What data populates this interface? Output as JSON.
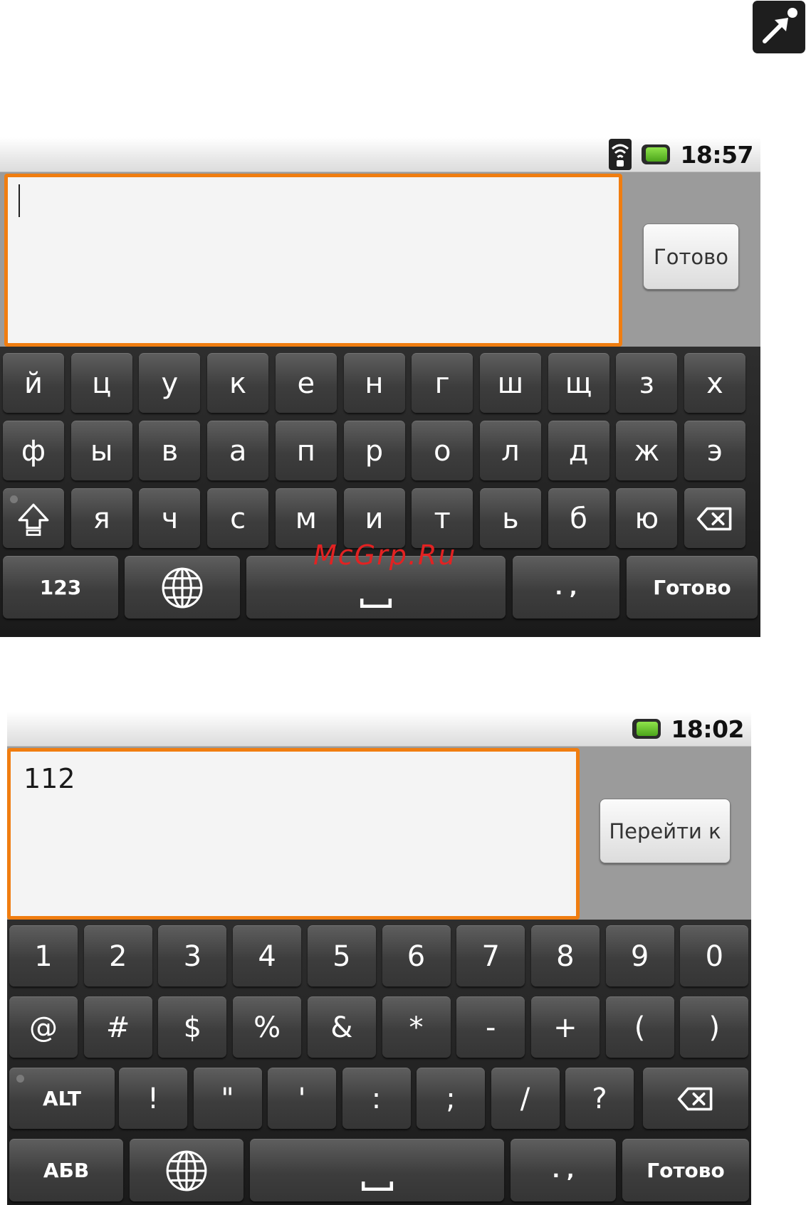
{
  "watermark": "McGrp.Ru",
  "corner_icon": "expand-arrow-icon",
  "screen1": {
    "status": {
      "time": "18:57",
      "icons": [
        "wifi-icon",
        "battery-icon"
      ]
    },
    "input": {
      "value": "",
      "action_label": "Готово"
    },
    "keyboard": {
      "rows": [
        [
          "й",
          "ц",
          "у",
          "к",
          "е",
          "н",
          "г",
          "ш",
          "щ",
          "з",
          "х"
        ],
        [
          "ф",
          "ы",
          "в",
          "а",
          "п",
          "р",
          "о",
          "л",
          "д",
          "ж",
          "э"
        ],
        [
          "я",
          "ч",
          "с",
          "м",
          "и",
          "т",
          "ь",
          "б",
          "ю"
        ]
      ],
      "bottom": {
        "mode_label": "123",
        "punct_label": ". ,",
        "done_label": "Готово"
      }
    }
  },
  "screen2": {
    "status": {
      "time": "18:02",
      "icons": [
        "battery-icon"
      ]
    },
    "input": {
      "value": "112",
      "action_label": "Перейти к"
    },
    "keyboard": {
      "rows": [
        [
          "1",
          "2",
          "3",
          "4",
          "5",
          "6",
          "7",
          "8",
          "9",
          "0"
        ],
        [
          "@",
          "#",
          "$",
          "%",
          "&",
          "*",
          "-",
          "+",
          "(",
          ")"
        ],
        [
          "!",
          "\"",
          "'",
          ":",
          ";",
          "/",
          "?"
        ]
      ],
      "alt_label": "ALT",
      "bottom": {
        "mode_label": "АБВ",
        "punct_label": ". ,",
        "done_label": "Готово"
      }
    }
  }
}
